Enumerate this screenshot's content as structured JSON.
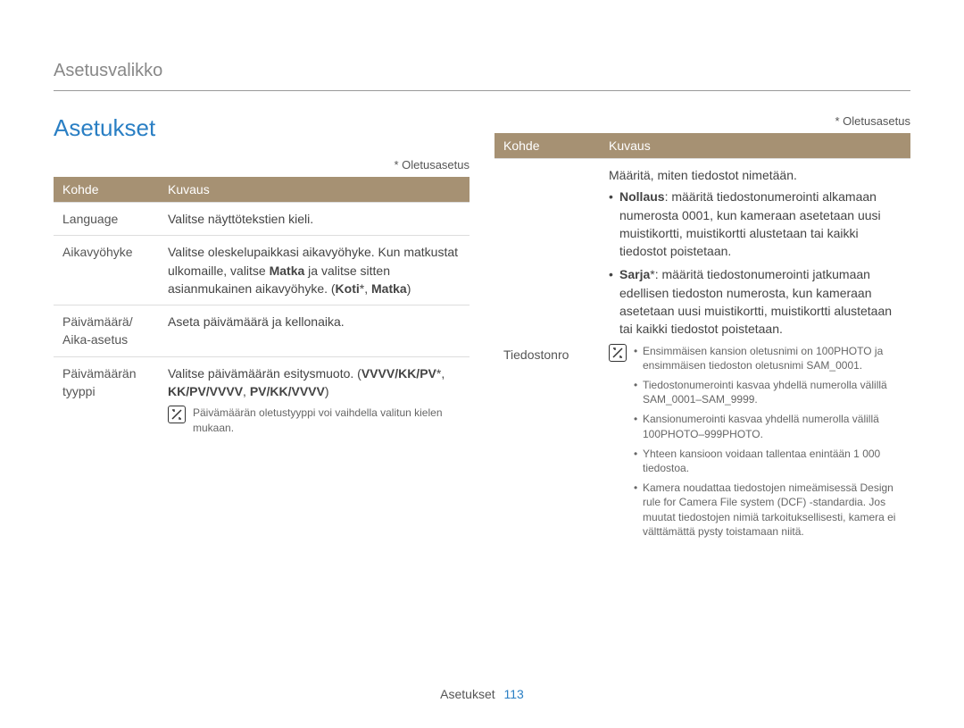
{
  "breadcrumb": "Asetusvalikko",
  "title": "Asetukset",
  "defaultNote": "* Oletusasetus",
  "headers": {
    "kohde": "Kohde",
    "kuvaus": "Kuvaus"
  },
  "left": {
    "rows": [
      {
        "label": "Language",
        "desc_plain": "Valitse näyttötekstien kieli."
      },
      {
        "label": "Aikavyöhyke",
        "desc_pre": "Valitse oleskelupaikkasi aikavyöhyke. Kun matkustat ulkomaille, valitse ",
        "bold1": "Matka",
        "desc_mid": " ja valitse sitten asianmukainen aikavyöhyke. (",
        "bold2": "Koti",
        "star1": "*",
        "sep": ", ",
        "bold3": "Matka",
        "desc_post": ")"
      },
      {
        "label": "Päivämäärä/\nAika-asetus",
        "desc_plain": "Aseta päivämäärä ja kellonaika."
      },
      {
        "label": "Päivämäärän tyyppi",
        "desc_pre": "Valitse päivämäärän esitysmuoto. (",
        "bold1": "VVVV/KK/PV",
        "star1": "*",
        "sep1": ", ",
        "bold2": "KK/PV/VVVV",
        "sep2": ", ",
        "bold3": "PV/KK/VVVV",
        "desc_post": ")",
        "note": "Päivämäärän oletustyyppi voi vaihdella valitun kielen mukaan."
      }
    ]
  },
  "right": {
    "row": {
      "label": "Tiedostonro",
      "lead": "Määritä, miten tiedostot nimetään.",
      "items": [
        {
          "bold": "Nollaus",
          "text": ": määritä tiedostonumerointi alkamaan numerosta 0001, kun kameraan asetetaan uusi muistikortti, muistikortti alustetaan tai kaikki tiedostot poistetaan."
        },
        {
          "bold": "Sarja",
          "star": "*",
          "text": ": määritä tiedostonumerointi jatkumaan edellisen tiedoston numerosta, kun kameraan asetetaan uusi muistikortti, muistikortti alustetaan tai kaikki tiedostot poistetaan."
        }
      ],
      "notes": [
        "Ensimmäisen kansion oletusnimi on 100PHOTO ja ensimmäisen tiedoston oletusnimi SAM_0001.",
        "Tiedostonumerointi kasvaa yhdellä numerolla välillä SAM_0001–SAM_9999.",
        "Kansionumerointi kasvaa yhdellä numerolla välillä 100PHOTO–999PHOTO.",
        "Yhteen kansioon voidaan tallentaa enintään 1 000 tiedostoa.",
        "Kamera noudattaa tiedostojen nimeämisessä Design rule for Camera File system (DCF) -standardia. Jos muutat tiedostojen nimiä tarkoituksellisesti, kamera ei välttämättä pysty toistamaan niitä."
      ]
    }
  },
  "footer": {
    "section": "Asetukset",
    "page": "113"
  }
}
